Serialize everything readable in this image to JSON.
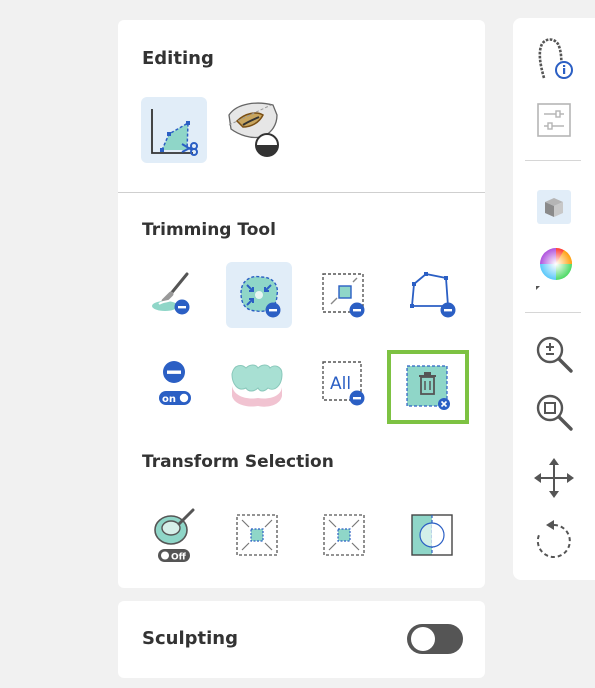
{
  "editing": {
    "title": "Editing",
    "tools": [
      {
        "icon": "trim-cut-icon",
        "selected": true
      },
      {
        "icon": "tooth-cut-icon",
        "selected": false
      }
    ]
  },
  "trimming": {
    "title": "Trimming Tool",
    "row1": [
      {
        "icon": "brush-deselect-icon",
        "selected": false
      },
      {
        "icon": "shrink-region-icon",
        "selected": true
      },
      {
        "icon": "box-deselect-icon",
        "selected": false
      },
      {
        "icon": "polygon-deselect-icon",
        "selected": false
      }
    ],
    "row2": [
      {
        "icon": "deselect-toggle-icon",
        "selected": false,
        "toggle_label": "on"
      },
      {
        "icon": "teeth-mesh-icon",
        "selected": false
      },
      {
        "icon": "deselect-all-icon",
        "selected": false,
        "label": "All"
      },
      {
        "icon": "delete-selection-icon",
        "selected": false,
        "highlighted": true
      }
    ]
  },
  "transform": {
    "title": "Transform Selection",
    "tools": [
      {
        "icon": "fill-holes-icon",
        "toggle_label": "Off"
      },
      {
        "icon": "shrink-selection-icon"
      },
      {
        "icon": "expand-selection-icon"
      },
      {
        "icon": "invert-selection-icon"
      }
    ]
  },
  "sculpting": {
    "title": "Sculpting",
    "toggle": "off"
  },
  "toolbar": {
    "icons": [
      "scan-info-icon",
      "settings-sliders-icon",
      "cube-view-icon",
      "color-wheel-icon",
      "zoom-in-out-icon",
      "zoom-fit-icon",
      "pan-icon",
      "rotate-icon"
    ]
  },
  "colors": {
    "accent_blue": "#2b5fc4",
    "selection_teal": "#8fd6c8",
    "highlight_green": "#7dc242",
    "selected_bg": "#e1edf8"
  }
}
